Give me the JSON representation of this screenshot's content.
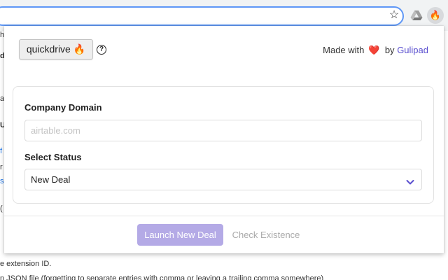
{
  "browser": {
    "star_icon": "star-icon",
    "star_glyph": "☆",
    "extensions": [
      {
        "name": "drive-icon"
      },
      {
        "name": "fire-icon",
        "glyph": "🔥"
      }
    ]
  },
  "background_page": {
    "left_fragments": [
      "h",
      "d",
      "a",
      "U",
      "f",
      "r",
      "s",
      "("
    ],
    "left_fragment_colors": [
      "#333333",
      "#333333",
      "#333333",
      "#333333",
      "#1a73e8",
      "#333333",
      "#1a73e8",
      "#333333"
    ],
    "line_extension_id": "e extension ID.",
    "line_json_hint": "n JSON file (forgetting to separate entries with comma or leaving a trailing comma somewhere)"
  },
  "popup": {
    "brand": "quickdrive 🔥",
    "help_glyph": "?",
    "made_with_prefix": "Made with",
    "heart": "❤️",
    "by_text": "by",
    "author": "Gulipad",
    "form": {
      "domain_label": "Company Domain",
      "domain_value": "",
      "domain_placeholder": "airtable.com",
      "status_label": "Select Status",
      "status_selected": "New Deal"
    },
    "actions": {
      "launch_label": "Launch New Deal",
      "check_label": "Check Existence"
    }
  },
  "colors": {
    "accent": "#5a4fcf",
    "launch_button_bg": "#b4aae6",
    "heart": "#e0314b",
    "omnibox_focus": "#5e97f6"
  }
}
